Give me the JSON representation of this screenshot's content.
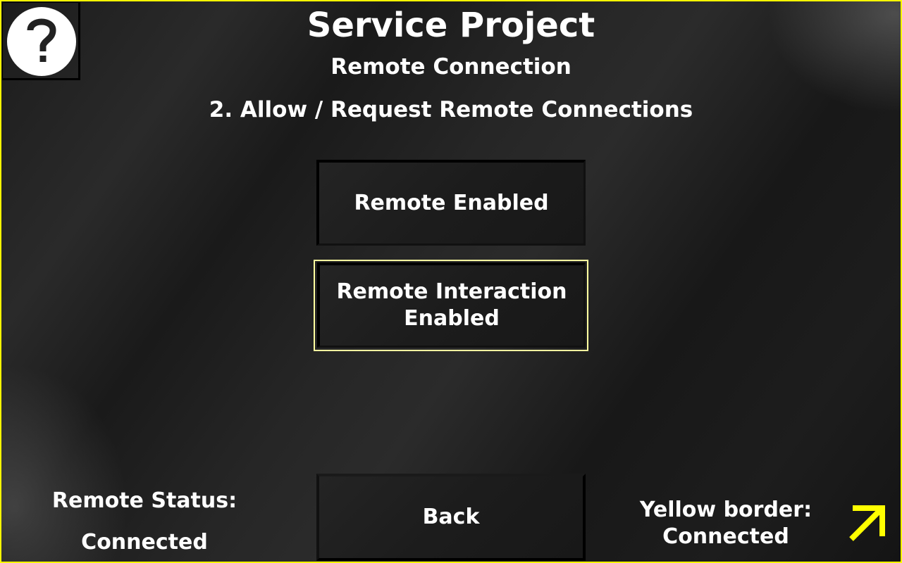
{
  "header": {
    "title": "Service Project",
    "subtitle": "Remote Connection",
    "step": "2. Allow / Request Remote Connections"
  },
  "help": {
    "icon": "question-mark-icon"
  },
  "buttons": {
    "remote_enabled": "Remote Enabled",
    "remote_interaction_line1": "Remote Interaction",
    "remote_interaction_line2": "Enabled",
    "back": "Back"
  },
  "status": {
    "label": "Remote Status:",
    "value": "Connected"
  },
  "legend": {
    "line1": "Yellow border:",
    "line2": "Connected",
    "icon": "arrow-up-right-icon"
  },
  "colors": {
    "connected_border": "#ffff00",
    "selected_button_border": "#ffffa0",
    "text": "#ffffff"
  }
}
